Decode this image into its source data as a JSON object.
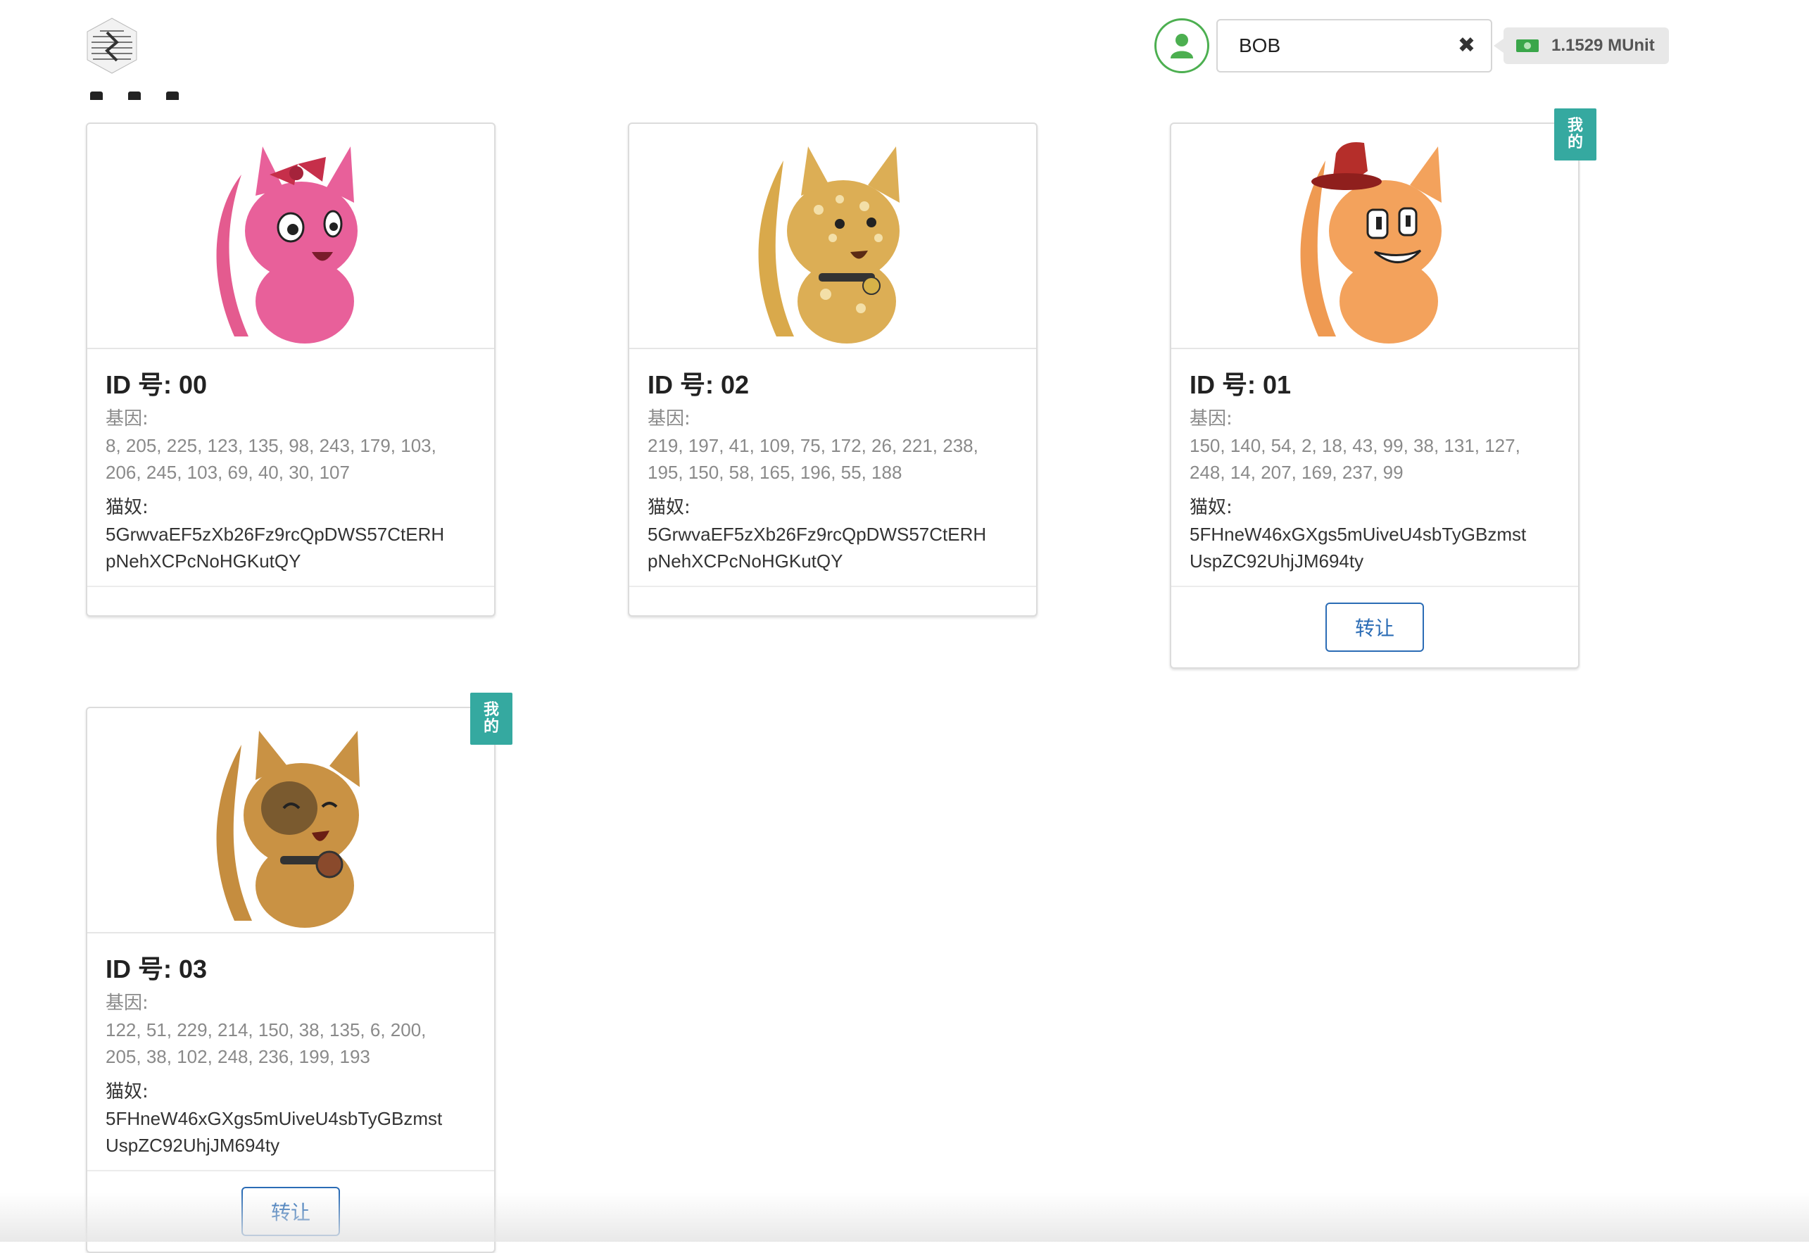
{
  "header": {
    "account_name": "BOB",
    "balance": "1.1529 MUnit",
    "clear_icon": "close-icon",
    "avatar_icon": "user-icon",
    "money_icon": "banknote-icon"
  },
  "colors": {
    "avatar_border": "#4caf50",
    "badge_bg": "#35a9a0",
    "button_blue": "#2b6cb5"
  },
  "cards": [
    {
      "title": "ID 号: 00",
      "genes_label": "基因:",
      "genes_line1": "8, 205, 225, 123, 135, 98, 243, 179, 103,",
      "genes_line2": "206, 245, 103, 69, 40, 30, 107",
      "owner_label": "猫奴:",
      "owner_line1": "5GrwvaEF5zXb26Fz9rcQpDWS57CtERH",
      "owner_line2": "pNehXCPcNoHGKutQY",
      "image_icon": "pink-cat-with-bow-icon"
    },
    {
      "title": "ID 号: 02",
      "genes_label": "基因:",
      "genes_line1": "219, 197, 41, 109, 75, 172, 26, 221, 238,",
      "genes_line2": "195, 150, 58, 165, 196, 55, 188",
      "owner_label": "猫奴:",
      "owner_line1": "5GrwvaEF5zXb26Fz9rcQpDWS57CtERH",
      "owner_line2": "pNehXCPcNoHGKutQY",
      "image_icon": "spotted-cat-with-bell-icon"
    },
    {
      "title": "ID 号: 01",
      "genes_label": "基因:",
      "genes_line1": "150, 140, 54, 2, 18, 43, 99, 38, 131, 127,",
      "genes_line2": "248, 14, 207, 169, 237, 99",
      "owner_label": "猫奴:",
      "owner_line1": "5FHneW46xGXgs5mUiveU4sbTyGBzmst",
      "owner_line2": "UspZC92UhjJM694ty",
      "badge_line1": "我",
      "badge_line2": "的",
      "transfer_label": "转让",
      "image_icon": "orange-cat-with-hat-icon"
    },
    {
      "title": "ID 号: 03",
      "genes_label": "基因:",
      "genes_line1": "122, 51, 229, 214, 150, 38, 135, 6, 200,",
      "genes_line2": "205, 38, 102, 248, 236, 199, 193",
      "owner_label": "猫奴:",
      "owner_line1": "5FHneW46xGXgs5mUiveU4sbTyGBzmst",
      "owner_line2": "UspZC92UhjJM694ty",
      "badge_line1": "我",
      "badge_line2": "的",
      "transfer_label": "转让",
      "image_icon": "brown-cat-with-collar-icon"
    }
  ]
}
